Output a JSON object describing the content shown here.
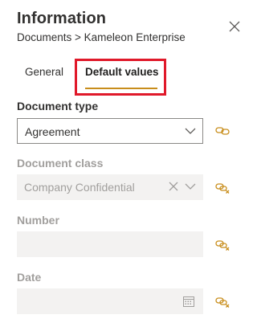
{
  "panel": {
    "title": "Information",
    "breadcrumb": "Documents > Kameleon Enterprise"
  },
  "tabs": [
    {
      "label": "General",
      "selected": false
    },
    {
      "label": "Default values",
      "selected": true
    }
  ],
  "fields": {
    "document_type": {
      "label": "Document type",
      "value": "Agreement",
      "enabled": true
    },
    "document_class": {
      "label": "Document class",
      "value": "Company Confidential",
      "enabled": false
    },
    "number": {
      "label": "Number",
      "value": "",
      "enabled": false
    },
    "date": {
      "label": "Date",
      "value": "",
      "enabled": false
    }
  },
  "icons": {
    "close": "close-icon",
    "chevron": "chevron-down-icon",
    "clear": "clear-icon",
    "calendar": "calendar-icon",
    "link": "link-icon",
    "unlink": "unlink-icon"
  },
  "colors": {
    "accent": "#c88d1b",
    "highlight": "#e0192a",
    "disabled_bg": "#f3f2f1",
    "disabled_text": "#a19f9d"
  }
}
